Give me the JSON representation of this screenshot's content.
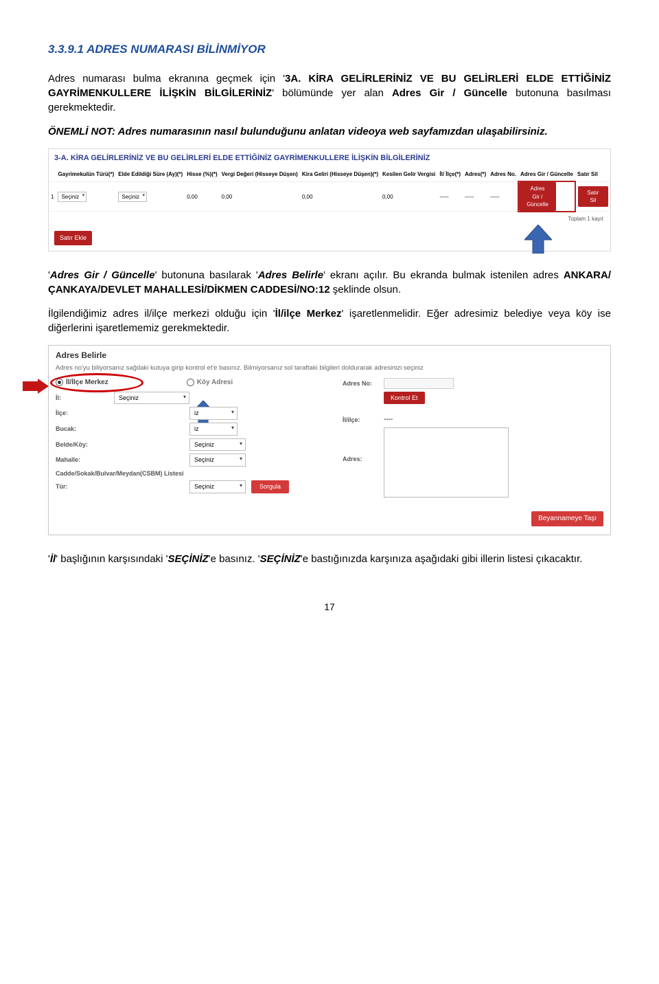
{
  "heading": "3.3.9.1  ADRES NUMARASI BİLİNMİYOR",
  "p1_a": "Adres numarası bulma ekranına geçmek için '",
  "p1_b": "3A. KİRA GELİRLERİNİZ VE BU GELİRLERİ ELDE ETTİĞİNİZ GAYRİMENKULLERE İLİŞKİN BİLGİLERİNİZ",
  "p1_c": "' bölümünde yer alan ",
  "p1_d": "Adres Gir / Güncelle",
  "p1_e": " butonuna basılması gerekmektedir.",
  "p2_a": "ÖNEMLİ NOT:",
  "p2_b": " Adres numarasının nasıl bulunduğunu anlatan videoya web sayfamızdan ulaşabilirsiniz.",
  "panel1": {
    "title": "3-A. KİRA GELİRLERİNİZ VE BU GELİRLERİ ELDE ETTİĞİNİZ GAYRİMENKULLERE İLİŞKİN BİLGİLERİNİZ",
    "cols": [
      "",
      "Gayrimekulün Türü(*)",
      "Elde Edildiği Süre (Ay)(*)",
      "Hisse (%)(*)",
      "Vergi Değeri (Hisseye Düşen)",
      "Kira Geliri (Hisseye Düşen)(*)",
      "Kesilen Gelir Vergisi",
      "İl/ İlçe(*)",
      "Adres(*)",
      "Adres No.",
      "Adres Gir / Güncelle",
      "Satır Sil"
    ],
    "row": {
      "idx": "1",
      "sel": "Seçiniz",
      "v1": "0,00",
      "v2": "0,00",
      "v3": "0,00",
      "v4": "0,00",
      "dash": "-----",
      "btn1a": "Adres",
      "btn1b": "Gir /",
      "btn1c": "Güncelle",
      "btn2a": "Satır",
      "btn2b": "Sil"
    },
    "toplam": "Toplam 1 kayıt",
    "ekle": "Satır Ekle"
  },
  "p3_a": "'",
  "p3_b": "Adres Gir / Güncelle",
  "p3_c": "' butonuna basılarak '",
  "p3_d": "Adres Belirle",
  "p3_e": "' ekranı açılır. Bu ekranda bulmak istenilen adres ",
  "p3_f": "ANKARA/ÇANKAYA/DEVLET MAHALLESİ/DİKMEN CADDESİ/NO:12",
  "p3_g": " şeklinde olsun.",
  "p4_a": "İlgilendiğimiz adres il/ilçe merkezi olduğu için '",
  "p4_b": "İl/ilçe Merkez",
  "p4_c": "' işaretlenmelidir. Eğer adresimiz belediye veya köy ise diğerlerini işaretlememiz gerekmektedir.",
  "panel2": {
    "title": "Adres Belirle",
    "desc": "Adres no'yu biliyorsanız sağdaki kutuya girip kontrol et'e basınız. Bilmiyorsanız sol taraftaki bilgileri doldurarak adresinizi seçiniz",
    "radio1": "İl/İlçe Merkez",
    "radio2": "Köy Adresi",
    "labels": {
      "il": "İl:",
      "ilce": "İlçe:",
      "bucak": "Bucak:",
      "belde": "Belde/Köy:",
      "mahalle": "Mahalle:",
      "csbm": "Cadde/Sokak/Bulvar/Meydan(CSBM) Listesi",
      "tur": "Tür:",
      "adresno": "Adres No:",
      "ililce": "İl/ilçe:",
      "adres": "Adres:"
    },
    "sel": "Seçiniz",
    "iz": "iz",
    "kontrol": "Kontrol Et",
    "sorgula": "Sorgula",
    "tasi": "Beyannameye Taşı",
    "dash": "----"
  },
  "p5_a": "'",
  "p5_b": "İl",
  "p5_c": "' başlığının karşısındaki '",
  "p5_d": "SEÇİNİZ",
  "p5_e": "'e basınız. '",
  "p5_f": "SEÇİNİZ",
  "p5_g": "'e bastığınızda karşınıza aşağıdaki gibi illerin listesi çıkacaktır.",
  "pagenum": "17"
}
